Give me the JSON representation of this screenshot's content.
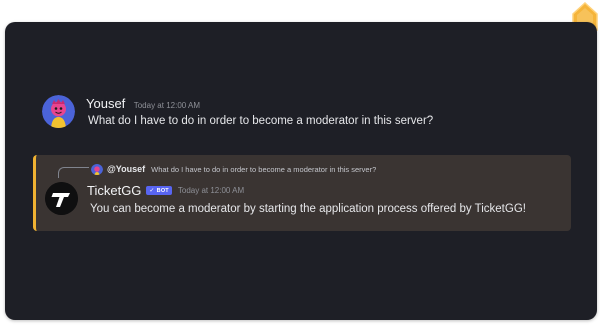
{
  "colors": {
    "background": "#1e1f26",
    "highlight_bg": "#3a3432",
    "highlight_accent": "#f0b232",
    "bot_tag": "#5865f2"
  },
  "messages": [
    {
      "author": "Yousef",
      "timestamp": "Today at 12:00 AM",
      "content": "What do I have to do in order to become a moderator in this server?"
    }
  ],
  "reply": {
    "reference": {
      "author": "@Yousef",
      "content": "What do I have to do in order to become a moderator in this server?"
    },
    "author": "TicketGG",
    "tag": "BOT",
    "timestamp": "Today at 12:00 AM",
    "content": "You can become a moderator by starting the application process offered by TicketGG!"
  }
}
